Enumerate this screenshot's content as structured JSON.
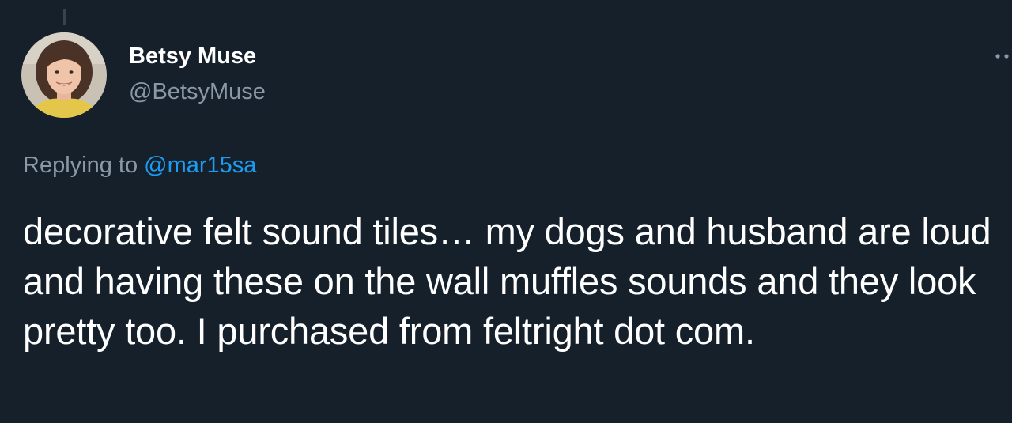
{
  "tweet": {
    "author_name": "Betsy Muse",
    "author_handle": "@BetsyMuse",
    "replying_prefix": "Replying to",
    "replying_to": "@mar15sa",
    "text": "decorative felt sound tiles… my dogs and husband are loud and having these on the wall muffles sounds and they look pretty too. I purchased from feltright dot com."
  },
  "icons": {
    "more": "more-horizontal-icon"
  },
  "colors": {
    "background": "#15202b",
    "primary_text": "#ffffff",
    "secondary_text": "#8b98a5",
    "link": "#1d9bf0"
  }
}
